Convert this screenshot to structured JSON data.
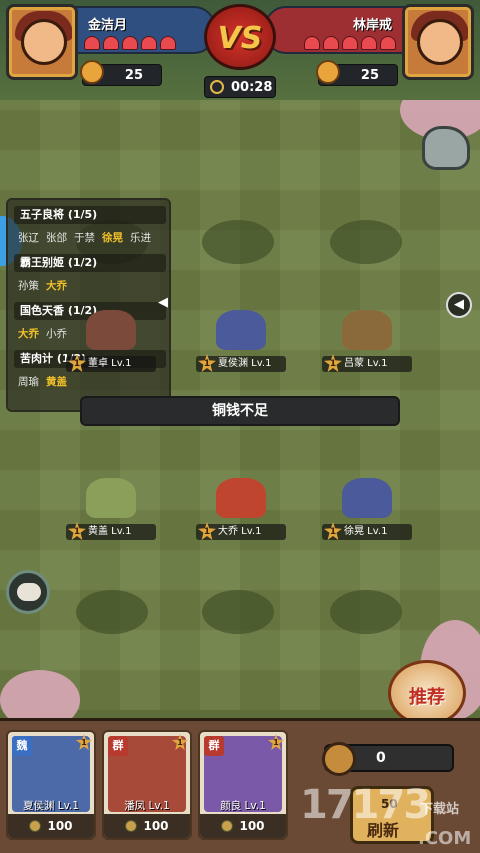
{
  "players": {
    "left": {
      "name": "金洁月",
      "hearts": 5,
      "coins": "25",
      "color": "#2f4f80"
    },
    "right": {
      "name": "林岸戒",
      "hearts": 5,
      "coins": "25",
      "color": "#9d2f33"
    }
  },
  "vs_label": "VS",
  "timer": "00:28",
  "combos": [
    {
      "title": "五子良将 (1/5)",
      "members": [
        {
          "n": "张辽",
          "hl": false
        },
        {
          "n": "张郃",
          "hl": false
        },
        {
          "n": "于禁",
          "hl": false
        },
        {
          "n": "徐晃",
          "hl": true
        },
        {
          "n": "乐进",
          "hl": false
        }
      ]
    },
    {
      "title": "霸王别姬 (1/2)",
      "members": [
        {
          "n": "孙策",
          "hl": false
        },
        {
          "n": "大乔",
          "hl": true
        }
      ]
    },
    {
      "title": "国色天香 (1/2)",
      "members": [
        {
          "n": "大乔",
          "hl": true
        },
        {
          "n": "小乔",
          "hl": false
        }
      ]
    },
    {
      "title": "苦肉计 (1/2)",
      "members": [
        {
          "n": "周瑜",
          "hl": false
        },
        {
          "n": "黄盖",
          "hl": true
        }
      ]
    }
  ],
  "units": [
    {
      "name": "董卓 Lv.1",
      "star": "1",
      "color": "#7b4a3a"
    },
    {
      "name": "夏侯渊 Lv.1",
      "star": "1",
      "color": "#4a5a9a"
    },
    {
      "name": "吕蒙 Lv.1",
      "star": "1",
      "color": "#8a6a3a"
    },
    {
      "name": "黄盖 Lv.1",
      "star": "1",
      "color": "#8aa05a"
    },
    {
      "name": "大乔 Lv.1",
      "star": "1",
      "color": "#c0452f"
    },
    {
      "name": "徐晃 Lv.1",
      "star": "1",
      "color": "#4a5a9a"
    }
  ],
  "toast": "铜钱不足",
  "recruit_label": "推荐",
  "shop_cards": [
    {
      "faction": "魏",
      "faction_color": "#3a6fc4",
      "name": "夏侯渊 Lv.1",
      "price": "100",
      "bg": "#4d6aa8",
      "star": "1"
    },
    {
      "faction": "群",
      "faction_color": "#b83a2f",
      "name": "潘凤 Lv.1",
      "price": "100",
      "bg": "#a84a3a",
      "star": "1"
    },
    {
      "faction": "群",
      "faction_color": "#b83a2f",
      "name": "颜良 Lv.1",
      "price": "100",
      "bg": "#7a5aa8",
      "star": "1"
    }
  ],
  "wallet": "0",
  "refresh": {
    "cost": "50",
    "label": "刷新"
  },
  "watermark": {
    "main": "17173",
    "sub": "下载站",
    "com": ".COM"
  }
}
